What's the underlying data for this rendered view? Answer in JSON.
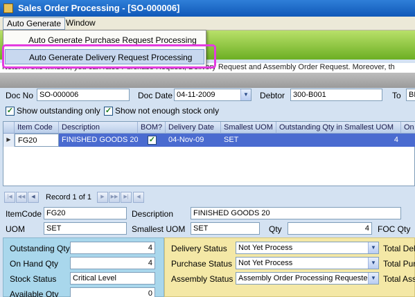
{
  "window": {
    "title": "Sales Order Processing - [SO-000006]"
  },
  "menu": {
    "auto_generate": "Auto Generate",
    "window": "Window"
  },
  "dropdown": {
    "items": [
      "Auto Generate Purchase Request Processing",
      "Auto Generate Delivery Request Processing"
    ]
  },
  "info_text": "Note: In this window, you can raise Purchase Request, Delivery Request and Assembly Order Request. Moreover, th",
  "header": {
    "doc_no_label": "Doc No",
    "doc_no": "SO-000006",
    "doc_date_label": "Doc Date",
    "doc_date": "04-11-2009",
    "debtor_label": "Debtor",
    "debtor": "300-B001",
    "to_label": "To",
    "to": "BE",
    "show_outstanding": "Show outstanding only",
    "show_not_enough": "Show not enough stock only"
  },
  "grid": {
    "columns": [
      "Item Code",
      "Description",
      "BOM?",
      "Delivery Date",
      "Smallest UOM",
      "Outstanding Qty in Smallest UOM",
      "On"
    ],
    "rows": [
      {
        "item_code": "FG20",
        "description": "FINISHED GOODS 20",
        "bom": true,
        "delivery_date": "04-Nov-09",
        "smallest_uom": "SET",
        "outstanding": "4"
      }
    ]
  },
  "navigator": {
    "record_text": "Record 1 of 1"
  },
  "detail": {
    "itemcode_label": "ItemCode",
    "itemcode": "FG20",
    "description_label": "Description",
    "description": "FINISHED GOODS 20",
    "uom_label": "UOM",
    "uom": "SET",
    "smallest_uom_label": "Smallest UOM",
    "smallest_uom": "SET",
    "qty_label": "Qty",
    "qty": "4",
    "foc_qty_label": "FOC Qty"
  },
  "left_panel": {
    "outstanding_label": "Outstanding Qty",
    "outstanding": "4",
    "on_hand_label": "On Hand Qty",
    "on_hand": "4",
    "stock_status_label": "Stock Status",
    "stock_status": "Critical Level",
    "available_label": "Available Qty",
    "available": "0"
  },
  "right_panel": {
    "delivery_status_label": "Delivery Status",
    "delivery_status": "Not Yet Process",
    "purchase_status_label": "Purchase Status",
    "purchase_status": "Not Yet Process",
    "assembly_status_label": "Assembly Status",
    "assembly_status": "Assembly Order Processing Requested",
    "total_del_label": "Total Deli",
    "total_pur_label": "Total Purc",
    "total_ass_label": "Total Ass"
  },
  "colors": {
    "title_bar": "#1a63c6",
    "highlight_row": "#4a6bd0",
    "toolbar_green": "#8cc63f",
    "callout": "#e43be0"
  }
}
